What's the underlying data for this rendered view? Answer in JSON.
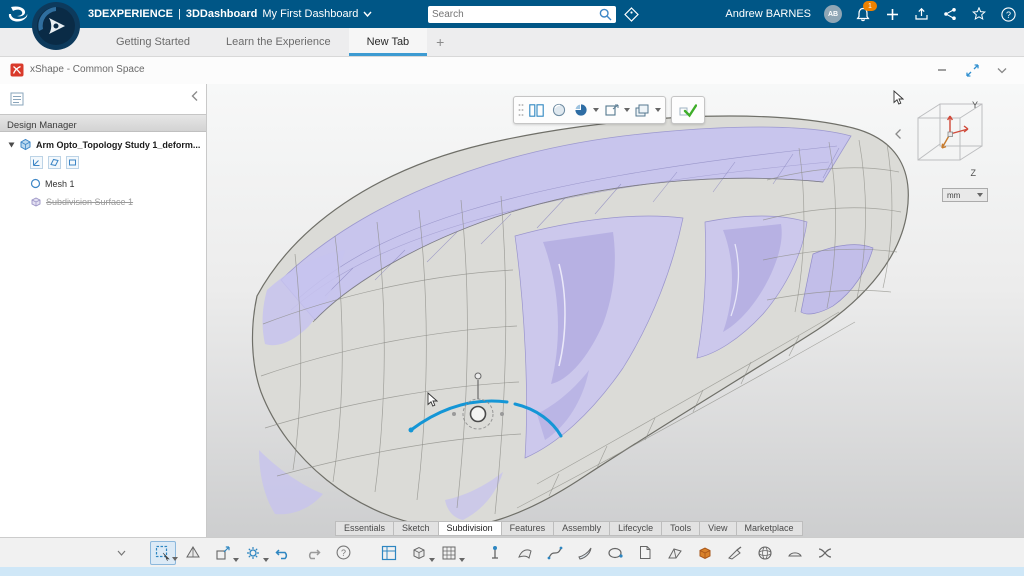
{
  "top_bar": {
    "brand": "3DEXPERIENCE",
    "separator": "|",
    "app_name": "3DDashboard",
    "dashboard_name": "My First Dashboard",
    "search": {
      "placeholder": "Search"
    },
    "user": {
      "name": "Andrew BARNES",
      "initials": "AB"
    },
    "notification_count": "1",
    "colors": {
      "bar_blue": "#005686",
      "badge_orange": "#ef8200"
    }
  },
  "tab_bar": {
    "tabs": [
      {
        "label": "Getting Started",
        "active": false
      },
      {
        "label": "Learn the Experience",
        "active": false
      },
      {
        "label": "New Tab",
        "active": true
      }
    ],
    "add_tab_label": "+"
  },
  "app_window": {
    "title": "xShape - Common Space"
  },
  "design_manager": {
    "title": "Design Manager",
    "tree": {
      "root_label": "Arm Opto_Topology Study 1_deform...",
      "mesh_label": "Mesh 1",
      "subdivision_label": "Subdivision Surface 1"
    }
  },
  "viewport": {
    "units_label": "mm",
    "axis": {
      "y": "Y",
      "z": "Z"
    },
    "accent_blue": "#1496d6",
    "surface_purple": "#c7c4ef"
  },
  "floating_toolbar": {
    "icons": [
      "split-view-icon",
      "shaded-sphere-icon",
      "render-style-icon",
      "view-options-icon",
      "capture-layers-icon",
      "validate-check-icon"
    ]
  },
  "action_bar": {
    "tabs": [
      {
        "label": "Essentials",
        "active": false
      },
      {
        "label": "Sketch",
        "active": false
      },
      {
        "label": "Subdivision",
        "active": true
      },
      {
        "label": "Features",
        "active": false
      },
      {
        "label": "Assembly",
        "active": false
      },
      {
        "label": "Lifecycle",
        "active": false
      },
      {
        "label": "Tools",
        "active": false
      },
      {
        "label": "View",
        "active": false
      },
      {
        "label": "Marketplace",
        "active": false
      }
    ]
  },
  "bottom_toolbar": {
    "tools": [
      "expand-chevron",
      "select-box-tool",
      "prism-tool",
      "export-shape-tool",
      "update-gear-tool",
      "undo",
      "redo",
      "help",
      "frame-view-tool",
      "cube-primitive-tool",
      "mesh-grid-tool",
      "pin-tool",
      "surface-patch-tool",
      "spline-tool",
      "blade-tool",
      "loop-tool",
      "sheet-tool",
      "fold-tool",
      "block-insert-tool",
      "scalpel-tool",
      "sphere-tool",
      "disc-tool",
      "twist-tool"
    ]
  },
  "icons": {
    "help_glyph": "?",
    "minimize_glyph": "—"
  }
}
